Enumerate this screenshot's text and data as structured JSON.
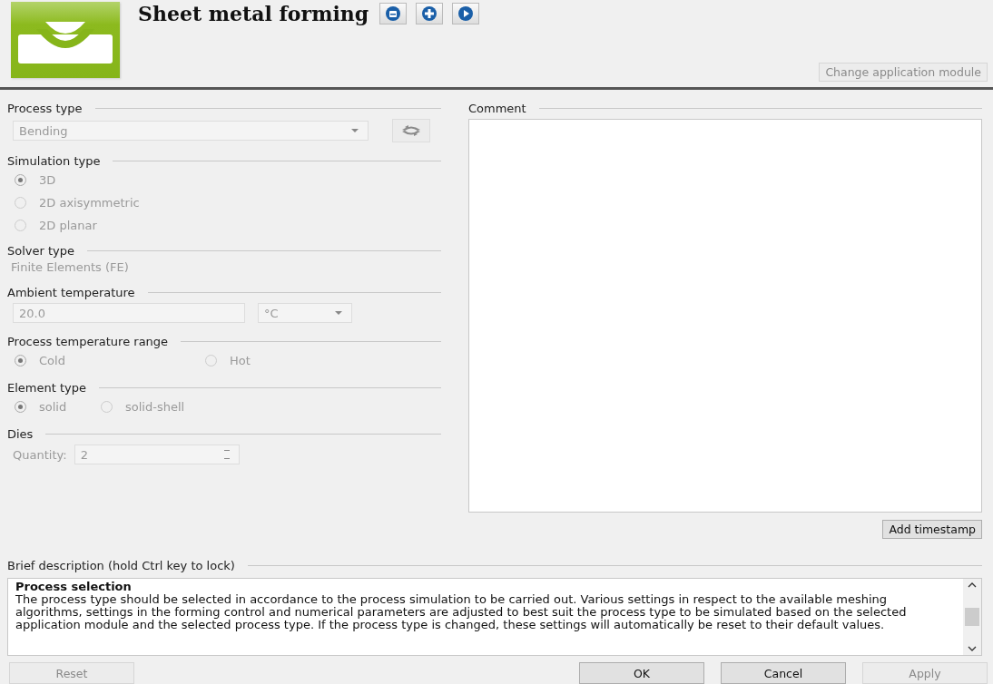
{
  "header": {
    "title": "Sheet metal forming",
    "change_module_button": {
      "label": "Change application module",
      "disabled": true
    }
  },
  "process_type": {
    "label": "Process type",
    "value": "Bending",
    "disabled": true
  },
  "simulation_type": {
    "label": "Simulation type",
    "disabled": true,
    "options": [
      {
        "label": "3D",
        "selected": true
      },
      {
        "label": "2D axisymmetric",
        "selected": false
      },
      {
        "label": "2D planar",
        "selected": false
      }
    ]
  },
  "solver_type": {
    "label": "Solver type",
    "value": "Finite Elements (FE)"
  },
  "ambient_temperature": {
    "label": "Ambient temperature",
    "value": "20.0",
    "unit": "°C",
    "disabled": true
  },
  "process_temperature_range": {
    "label": "Process temperature range",
    "disabled": true,
    "options": [
      {
        "label": "Cold",
        "selected": true
      },
      {
        "label": "Hot",
        "selected": false
      }
    ]
  },
  "element_type": {
    "label": "Element type",
    "disabled": true,
    "options": [
      {
        "label": "solid",
        "selected": true
      },
      {
        "label": "solid-shell",
        "selected": false
      }
    ]
  },
  "dies": {
    "label": "Dies",
    "quantity_label": "Quantity:",
    "quantity": "2",
    "disabled": true
  },
  "comment": {
    "label": "Comment",
    "add_timestamp": "Add timestamp"
  },
  "brief_description": {
    "label": "Brief description (hold Ctrl key to lock)",
    "heading": "Process selection",
    "text": "The process type should be selected in accordance to the process simulation to be carried out. Various settings in respect to the available meshing algorithms, settings in the forming control and numerical parameters are adjusted to best suit the process type to be simulated based on the selected application module and the selected process type. If the process type is changed, these settings will automatically be reset to their default values."
  },
  "buttons": [
    {
      "label": "Reset",
      "disabled": true
    },
    {
      "label": "OK",
      "disabled": false
    },
    {
      "label": "Cancel",
      "disabled": false
    },
    {
      "label": "Apply",
      "disabled": true
    }
  ]
}
